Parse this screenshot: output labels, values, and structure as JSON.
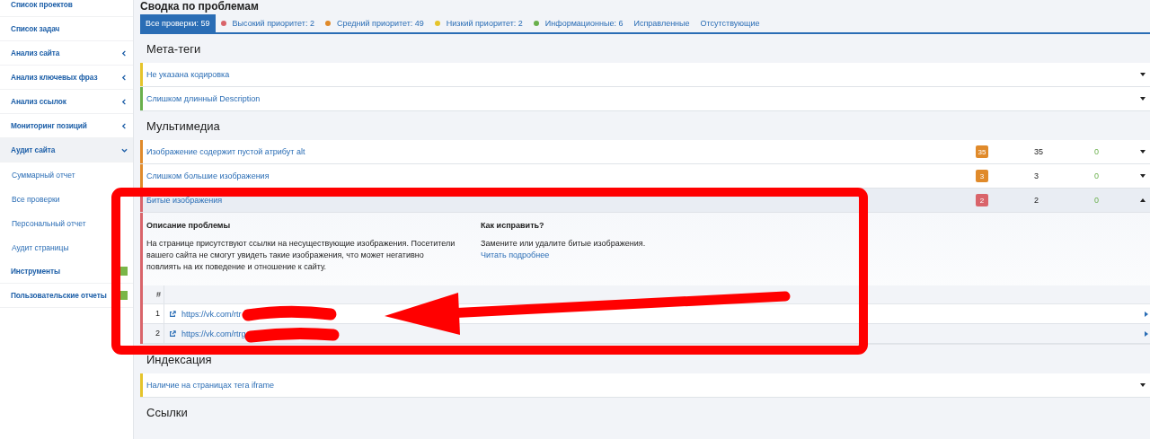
{
  "sidebar": {
    "items": [
      {
        "label": "Список проектов",
        "expanded": false,
        "has_submenu": false
      },
      {
        "label": "Список задач",
        "expanded": false,
        "has_submenu": false
      },
      {
        "label": "Анализ сайта",
        "expanded": false,
        "has_submenu": true
      },
      {
        "label": "Анализ ключевых фраз",
        "expanded": false,
        "has_submenu": true
      },
      {
        "label": "Анализ ссылок",
        "expanded": false,
        "has_submenu": true
      },
      {
        "label": "Мониторинг позиций",
        "expanded": false,
        "has_submenu": true
      },
      {
        "label": "Аудит сайта",
        "expanded": true,
        "has_submenu": true,
        "children": [
          {
            "label": "Суммарный отчет"
          },
          {
            "label": "Все проверки"
          },
          {
            "label": "Персональный отчет"
          },
          {
            "label": "Аудит страницы"
          }
        ]
      },
      {
        "label": "Инструменты",
        "expanded": false,
        "has_submenu": false,
        "badge": true
      },
      {
        "label": "Пользовательские отчеты",
        "expanded": false,
        "has_submenu": false,
        "badge": true
      }
    ]
  },
  "page_title": "Сводка по проблемам",
  "tabs": [
    {
      "label": "Все проверки: 59",
      "selected": true
    },
    {
      "label": "Высокий приоритет: 2",
      "selected": false,
      "color": "#d9646a"
    },
    {
      "label": "Средний приоритет: 49",
      "selected": false,
      "color": "#e08a2a"
    },
    {
      "label": "Низкий приоритет: 2",
      "selected": false,
      "color": "#e5c42b"
    },
    {
      "label": "Информационные: 6",
      "selected": false,
      "color": "#6ab04c"
    },
    {
      "label": "Исправленные",
      "selected": false
    },
    {
      "label": "Отсутствующие",
      "selected": false
    }
  ],
  "sections": [
    {
      "title": "Мета-теги",
      "issues": [
        {
          "title": "Не указана кодировка",
          "color": "#e5c42b",
          "expanded": false
        },
        {
          "title": "Слишком длинный Description",
          "color": "#6ab04c",
          "expanded": false
        }
      ]
    },
    {
      "title": "Мультимедиа",
      "issues": [
        {
          "title": "Изображение содержит пустой атрибут alt",
          "color": "#e08a2a",
          "badge": "35",
          "count": "35",
          "fixed": "0",
          "expanded": false
        },
        {
          "title": "Слишком большие изображения",
          "color": "#e08a2a",
          "badge": "3",
          "count": "3",
          "fixed": "0",
          "expanded": false
        },
        {
          "title": "Битые изображения",
          "color": "#d9646a",
          "badge": "2",
          "count": "2",
          "fixed": "0",
          "expanded": true,
          "details": {
            "problem_heading": "Описание проблемы",
            "problem_text": "На странице присутствуют ссылки на несуществующие изображения. Посетители вашего сайта не смогут увидеть такие изображения, что может негативно повлиять на их поведение и отношение к сайту.",
            "fix_heading": "Как исправить?",
            "fix_text": "Замените или удалите битые изображения.",
            "fix_link": "Читать подробнее",
            "table_header": "#",
            "rows": [
              {
                "num": "1",
                "url": "https://vk.com/rtr"
              },
              {
                "num": "2",
                "url": "https://vk.com/rtrg"
              }
            ]
          }
        }
      ]
    },
    {
      "title": "Индексация",
      "issues": [
        {
          "title": "Наличие на страницах тега iframe",
          "color": "#e5c42b",
          "expanded": false
        }
      ]
    },
    {
      "title": "Ссылки"
    }
  ]
}
